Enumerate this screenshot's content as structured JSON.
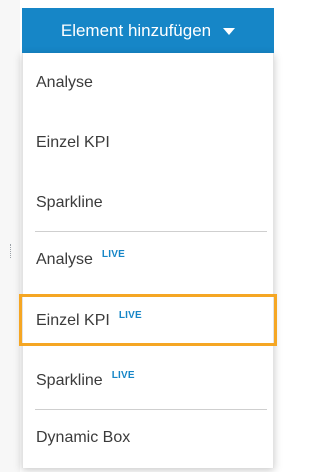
{
  "dropdown": {
    "button_label": "Element hinzufügen",
    "caret_icon": "caret-down-icon",
    "button_color": "#1686c7"
  },
  "menu": {
    "items": [
      {
        "label": "Analyse",
        "badge": ""
      },
      {
        "label": "Einzel KPI",
        "badge": ""
      },
      {
        "label": "Sparkline",
        "badge": ""
      },
      {
        "label": "Analyse",
        "badge": "LIVE"
      },
      {
        "label": "Einzel KPI",
        "badge": "LIVE"
      },
      {
        "label": "Sparkline",
        "badge": "LIVE"
      },
      {
        "label": "Dynamic Box",
        "badge": ""
      }
    ],
    "highlight_color": "#f5a623",
    "live_color": "#1686c7"
  }
}
